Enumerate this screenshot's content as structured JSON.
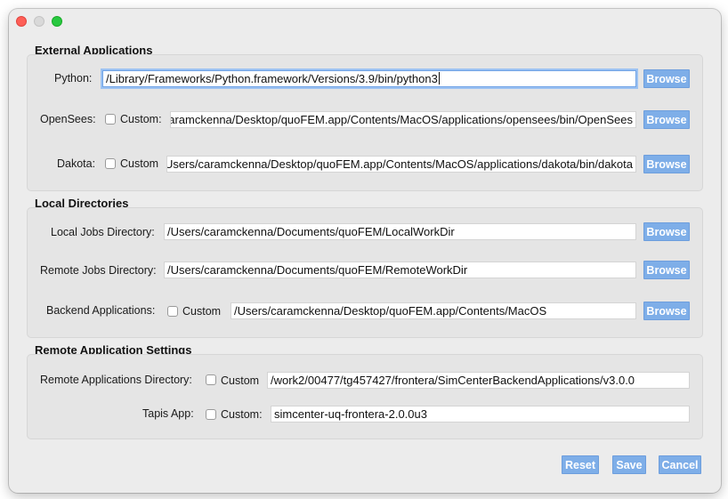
{
  "sections": {
    "external": {
      "title": "External Applications",
      "python": {
        "label": "Python:",
        "value": "/Library/Frameworks/Python.framework/Versions/3.9/bin/python3"
      },
      "opensees": {
        "label": "OpenSees:",
        "custom_label": "Custom:",
        "value": "/Users/caramckenna/Desktop/quoFEM.app/Contents/MacOS/applications/opensees/bin/OpenSees"
      },
      "dakota": {
        "label": "Dakota:",
        "custom_label": "Custom",
        "value": "/Users/caramckenna/Desktop/quoFEM.app/Contents/MacOS/applications/dakota/bin/dakota"
      }
    },
    "local": {
      "title": "Local Directories",
      "local_jobs": {
        "label": "Local Jobs Directory:",
        "value": "/Users/caramckenna/Documents/quoFEM/LocalWorkDir"
      },
      "remote_jobs": {
        "label": "Remote Jobs Directory:",
        "value": "/Users/caramckenna/Documents/quoFEM/RemoteWorkDir"
      },
      "backend": {
        "label": "Backend Applications:",
        "custom_label": "Custom",
        "value": "/Users/caramckenna/Desktop/quoFEM.app/Contents/MacOS"
      }
    },
    "remote": {
      "title": "Remote Application Settings",
      "remote_apps": {
        "label": "Remote Applications Directory:",
        "custom_label": "Custom",
        "value": "/work2/00477/tg457427/frontera/SimCenterBackendApplications/v3.0.0"
      },
      "tapis": {
        "label": "Tapis App:",
        "custom_label": "Custom:",
        "value": "simcenter-uq-frontera-2.0.0u3"
      }
    }
  },
  "buttons": {
    "browse": "Browse",
    "reset": "Reset",
    "save": "Save",
    "cancel": "Cancel"
  },
  "colors": {
    "button": "#7eaee8",
    "focus_ring": "#9cc2f2"
  }
}
